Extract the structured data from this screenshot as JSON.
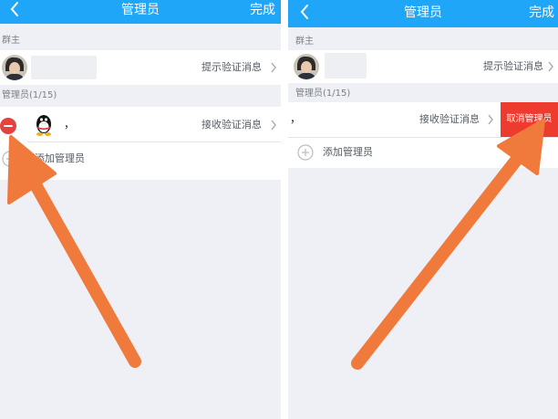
{
  "header": {
    "title": "管理员",
    "done_label": "完成"
  },
  "left": {
    "owner_section_label": "群主",
    "owner_link": "提示验证消息",
    "admin_section_label": "管理员(1/15)",
    "admin_name": "，",
    "admin_link": "接收验证消息",
    "add_admin_label": "添加管理员"
  },
  "right": {
    "owner_section_label": "群主",
    "owner_link": "提示验证消息",
    "admin_section_label": "管理员(1/15)",
    "admin_name": "，",
    "admin_link": "接收验证消息",
    "cancel_admin_label": "取消管理员",
    "add_admin_label": "添加管理员"
  },
  "colors": {
    "header_bg": "#20a6f8",
    "remove_icon": "#e4423f",
    "cancel_button": "#ee3b30",
    "annotation_arrow": "#f07a3c"
  }
}
